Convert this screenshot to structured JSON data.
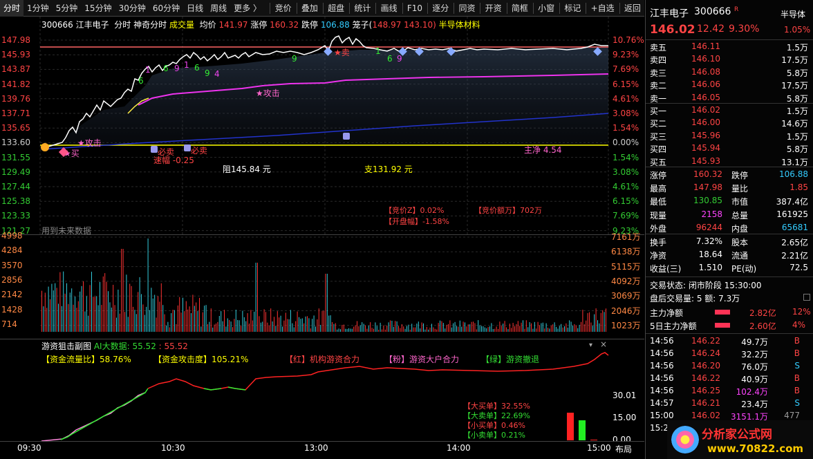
{
  "toolbar": {
    "left": [
      "分时",
      "1分钟",
      "5分钟",
      "15分钟",
      "30分钟",
      "60分钟",
      "日线",
      "周线",
      "更多 〉"
    ],
    "right": [
      "竞价",
      "叠加",
      "超盘",
      "统计",
      "画线",
      "F10",
      "逐分",
      "同资",
      "开资",
      "简框",
      "小窗",
      "标记",
      "+自选",
      "返回"
    ]
  },
  "header": {
    "code": "300666",
    "name": "江丰电子",
    "mode": "分时",
    "indicator": "神奇分时",
    "vol_label": "成交量",
    "avg_label": "均价",
    "avg_value": "141.97",
    "limit_up_label": "涨停",
    "limit_up": "160.32",
    "limit_down_label": "跌停",
    "limit_down": "106.88",
    "cage_label": "笼子(",
    "cage_values": "148.97 143.10)",
    "sector": "半导体材料"
  },
  "price_axis": {
    "left": [
      "147.98",
      "145.93",
      "143.87",
      "141.82",
      "139.76",
      "137.71",
      "135.65",
      "133.60",
      "131.55",
      "129.49",
      "127.44",
      "125.38",
      "123.33",
      "121.27"
    ],
    "right": [
      "10.76%",
      "9.23%",
      "7.69%",
      "6.15%",
      "4.61%",
      "3.08%",
      "1.54%",
      "0.00%",
      "1.54%",
      "3.08%",
      "4.61%",
      "6.15%",
      "7.69%",
      "9.23%"
    ]
  },
  "volume_axis": {
    "left": [
      "4998",
      "4284",
      "3570",
      "2856",
      "2142",
      "1428",
      "714"
    ],
    "right": [
      "7161万",
      "6138万",
      "5115万",
      "4092万",
      "3069万",
      "2046万",
      "1023万"
    ]
  },
  "annotations": {
    "buy": "★买",
    "attack1": "★攻击",
    "attack2": "★攻击",
    "sell": "★卖",
    "must_sell": "必卖",
    "spd": "速幅 -0.25",
    "resist": "阻145.84 元",
    "support": "支131.92 元",
    "main_net": "主净 4.54",
    "future_data": "用到未来数据",
    "auction_pct": "【竞价Z】0.02%",
    "auction_amt": "【竞价额万】702万",
    "open_amp": "【开盘幅】-1.58%",
    "digits": [
      "6",
      "1",
      "6",
      "9",
      "1",
      "6",
      "9",
      "4",
      "9",
      "1",
      "6",
      "9"
    ]
  },
  "sub_panel": {
    "title": "游资狙击副图",
    "ai_label": "AI大数据:",
    "ai_value1": "55.52",
    "ai_value2": "55.52",
    "flow_ratio": "【资金流量比】58.76%",
    "attack_deg": "【资金攻击度】105.21%",
    "red_legend": "【红】机构游资合力",
    "pink_legend": "【粉】游资大户合力",
    "green_legend": "【绿】游资撤退",
    "big_buy": "【大买单】32.55%",
    "big_sell": "【大卖单】22.69%",
    "small_buy": "【小买单】0.46%",
    "small_sell": "【小卖单】0.21%",
    "axis": [
      "30.01",
      "15.00",
      "0.00"
    ]
  },
  "time_axis": [
    "09:30",
    "10:30",
    "13:00",
    "14:00",
    "15:00"
  ],
  "layout_btn": "布局",
  "watermark": "分析家公式网 www.70822.com",
  "right_panel": {
    "name": "江丰电子",
    "code": "300666",
    "tag": "R",
    "sector": "半导体",
    "price": "146.02",
    "change": "12.42",
    "change_pct": "9.30%",
    "sector_pct": "1.05%",
    "asks": [
      {
        "label": "卖五",
        "price": "146.11",
        "vol": "1.5万"
      },
      {
        "label": "卖四",
        "price": "146.10",
        "vol": "17.5万"
      },
      {
        "label": "卖三",
        "price": "146.08",
        "vol": "5.8万"
      },
      {
        "label": "卖二",
        "price": "146.06",
        "vol": "17.5万"
      },
      {
        "label": "卖一",
        "price": "146.05",
        "vol": "5.8万"
      }
    ],
    "bids": [
      {
        "label": "买一",
        "price": "146.02",
        "vol": "1.5万"
      },
      {
        "label": "买二",
        "price": "146.00",
        "vol": "14.6万"
      },
      {
        "label": "买三",
        "price": "145.96",
        "vol": "1.5万"
      },
      {
        "label": "买四",
        "price": "145.94",
        "vol": "5.8万"
      },
      {
        "label": "买五",
        "price": "145.93",
        "vol": "13.1万"
      }
    ],
    "stats": [
      {
        "k1": "涨停",
        "v1": "160.32",
        "k2": "跌停",
        "v2": "106.88"
      },
      {
        "k1": "最高",
        "v1": "147.98",
        "k2": "量比",
        "v2": "1.85"
      },
      {
        "k1": "最低",
        "v1": "130.85",
        "k2": "市值",
        "v2": "387.4亿"
      },
      {
        "k1": "现量",
        "v1": "2158",
        "k2": "总量",
        "v2": "161925"
      },
      {
        "k1": "外盘",
        "v1": "96244",
        "k2": "内盘",
        "v2": "65681"
      }
    ],
    "stats2": [
      {
        "k1": "换手",
        "v1": "7.32%",
        "k2": "股本",
        "v2": "2.65亿"
      },
      {
        "k1": "净资",
        "v1": "18.64",
        "k2": "流通",
        "v2": "2.21亿"
      },
      {
        "k1": "收益(三)",
        "v1": "1.510",
        "k2": "PE(动)",
        "v2": "72.5"
      }
    ],
    "trade_status": "交易状态: 闭市阶段 15:30:00",
    "after_hours": "盘后交易量: 5  额: 7.3万",
    "main_net_label": "主力净额",
    "main_net_value": "2.82亿",
    "main_net_pct": "12%",
    "main5_label": "5日主力净额",
    "main5_value": "2.60亿",
    "main5_pct": "4%",
    "ticks": [
      {
        "t": "14:56",
        "p": "146.22",
        "v": "49.7万",
        "s": "B"
      },
      {
        "t": "14:56",
        "p": "146.24",
        "v": "32.2万",
        "s": "B"
      },
      {
        "t": "14:56",
        "p": "146.20",
        "v": "76.0万",
        "s": "S"
      },
      {
        "t": "14:56",
        "p": "146.22",
        "v": "40.9万",
        "s": "B"
      },
      {
        "t": "14:56",
        "p": "146.25",
        "v": "102.4万",
        "s": "B"
      },
      {
        "t": "14:57",
        "p": "146.21",
        "v": "23.4万",
        "s": "S"
      },
      {
        "t": "15:00",
        "p": "146.02",
        "v": "3151.1万",
        "s": "477"
      },
      {
        "t": "15:2",
        "p": "",
        "v": "",
        "s": ""
      }
    ],
    "logo_text": "分析家公式网",
    "logo_url": "www.70822.com"
  },
  "chart_data": {
    "type": "line",
    "title": "",
    "x": [
      "09:30",
      "10:30",
      "13:00",
      "14:00",
      "15:00"
    ],
    "series": [
      {
        "values": [
          133.6,
          131.55,
          136.5,
          141.8,
          143.9,
          144.5,
          145.0,
          146.0,
          146.0,
          145.9,
          146.02
        ]
      },
      {
        "values": [
          133.6,
          132.0,
          137.5,
          139.8,
          140.8,
          141.2,
          141.5,
          141.7,
          141.85,
          141.9,
          141.97
        ]
      }
    ],
    "ylim": [
      121.27,
      147.98
    ]
  }
}
